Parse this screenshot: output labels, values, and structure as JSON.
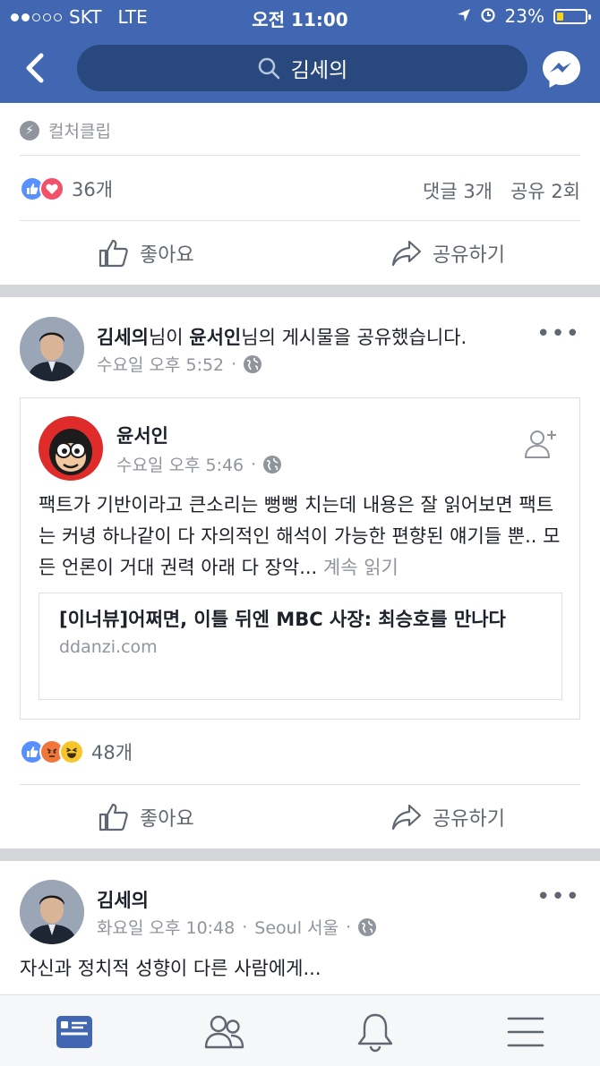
{
  "status_bar": {
    "carrier": "SKT",
    "network": "LTE",
    "time": "오전 11:00",
    "battery": "23%",
    "battery_level": 0.23
  },
  "nav": {
    "search_text": "김세의"
  },
  "post1": {
    "source": "컬처클립",
    "reaction_count": "36개",
    "comments": "댓글 3개",
    "shares": "공유 2회",
    "like_label": "좋아요",
    "share_label": "공유하기"
  },
  "post2": {
    "author": "김세의",
    "connector1": "님이 ",
    "shared_from": "윤서인",
    "connector2": "님의 게시물을 공유했습니다.",
    "time": "수요일 오후 5:52",
    "shared": {
      "author": "윤서인",
      "time": "수요일 오후 5:46",
      "text": "팩트가 기반이라고 큰소리는 뻥뻥 치는데 내용은 잘 읽어보면 팩트는 커녕 하나같이 다 자의적인 해석이 가능한 편향된 얘기들 뿐.. 모든 언론이 거대 권력 아래 다 장악... ",
      "see_more": "계속 읽기",
      "link_title": "[이너뷰]어쩌면, 이틀 뒤엔 MBC 사장: 최승호를 만나다",
      "link_domain": "ddanzi.com"
    },
    "reaction_count": "48개",
    "like_label": "좋아요",
    "share_label": "공유하기"
  },
  "post3": {
    "author": "김세의",
    "time": "화요일 오후 10:48",
    "location": "Seoul 서울",
    "text": "자신과 정치적 성향이 다른 사람에게..."
  },
  "colors": {
    "brand": "#4267b2",
    "brand_dark": "#29487d",
    "gray_text": "#90949c",
    "like_blue": "#5890ff",
    "love_red": "#f25268"
  }
}
